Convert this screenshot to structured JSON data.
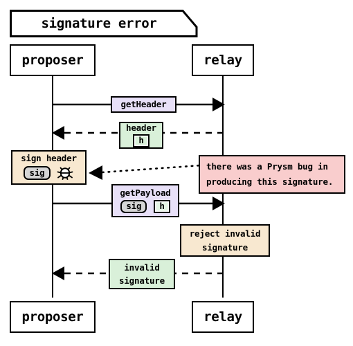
{
  "diagram": {
    "type": "sequence-diagram",
    "title": "signature error",
    "participants": [
      {
        "id": "proposer",
        "label": "proposer"
      },
      {
        "id": "relay",
        "label": "relay"
      }
    ],
    "colors": {
      "lavender": "#e8e0f8",
      "green": "#d9f0d9",
      "tan": "#f8e8d0",
      "pink": "#f9cdcd",
      "chip_gray": "#d5d5d5",
      "stroke": "#000000",
      "background": "#ffffff"
    },
    "messages": [
      {
        "id": "get-header",
        "label": "getHeader",
        "from": "proposer",
        "to": "relay",
        "style": "solid",
        "color": "lavender"
      },
      {
        "id": "header-response",
        "label": "header",
        "payload": "h",
        "from": "relay",
        "to": "proposer",
        "style": "dashed",
        "color": "green"
      },
      {
        "id": "sign-header",
        "label": "sign header",
        "payload": "sig",
        "icon": "bug-icon",
        "actor": "proposer",
        "style": "activation",
        "color": "tan"
      },
      {
        "id": "prysm-bug-note",
        "line1": "there was a Prysm bug in",
        "line2": "producing this signature.",
        "style": "dotted",
        "color": "pink"
      },
      {
        "id": "get-payload",
        "label": "getPayload",
        "payload_sig": "sig",
        "payload_h": "h",
        "from": "proposer",
        "to": "relay",
        "style": "solid",
        "color": "lavender"
      },
      {
        "id": "reject-invalid",
        "line1": "reject invalid",
        "line2": "signature",
        "actor": "relay",
        "style": "activation",
        "color": "tan"
      },
      {
        "id": "invalid-signature-response",
        "line1": "invalid",
        "line2": "signature",
        "from": "relay",
        "to": "proposer",
        "style": "dashed",
        "color": "green"
      }
    ]
  }
}
